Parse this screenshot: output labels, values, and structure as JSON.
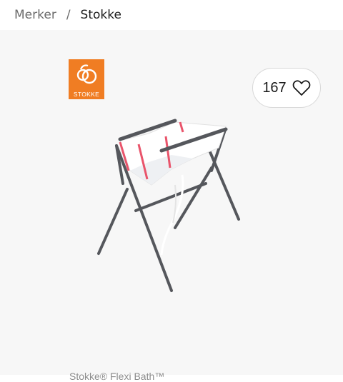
{
  "breadcrumb": {
    "parent": "Merker",
    "separator": "/",
    "current": "Stokke"
  },
  "logo": {
    "brand_text": "STOKKE",
    "color": "#f07d23"
  },
  "like": {
    "count": "167",
    "icon": "heart-outline-icon"
  },
  "product": {
    "caption": "Stokke® Flexi Bath™",
    "image_description_icon": "bath-stand-image"
  },
  "colors": {
    "image_background": "#f7f7f7",
    "accent_pink": "#e9546b",
    "frame_gray": "#55575c"
  }
}
